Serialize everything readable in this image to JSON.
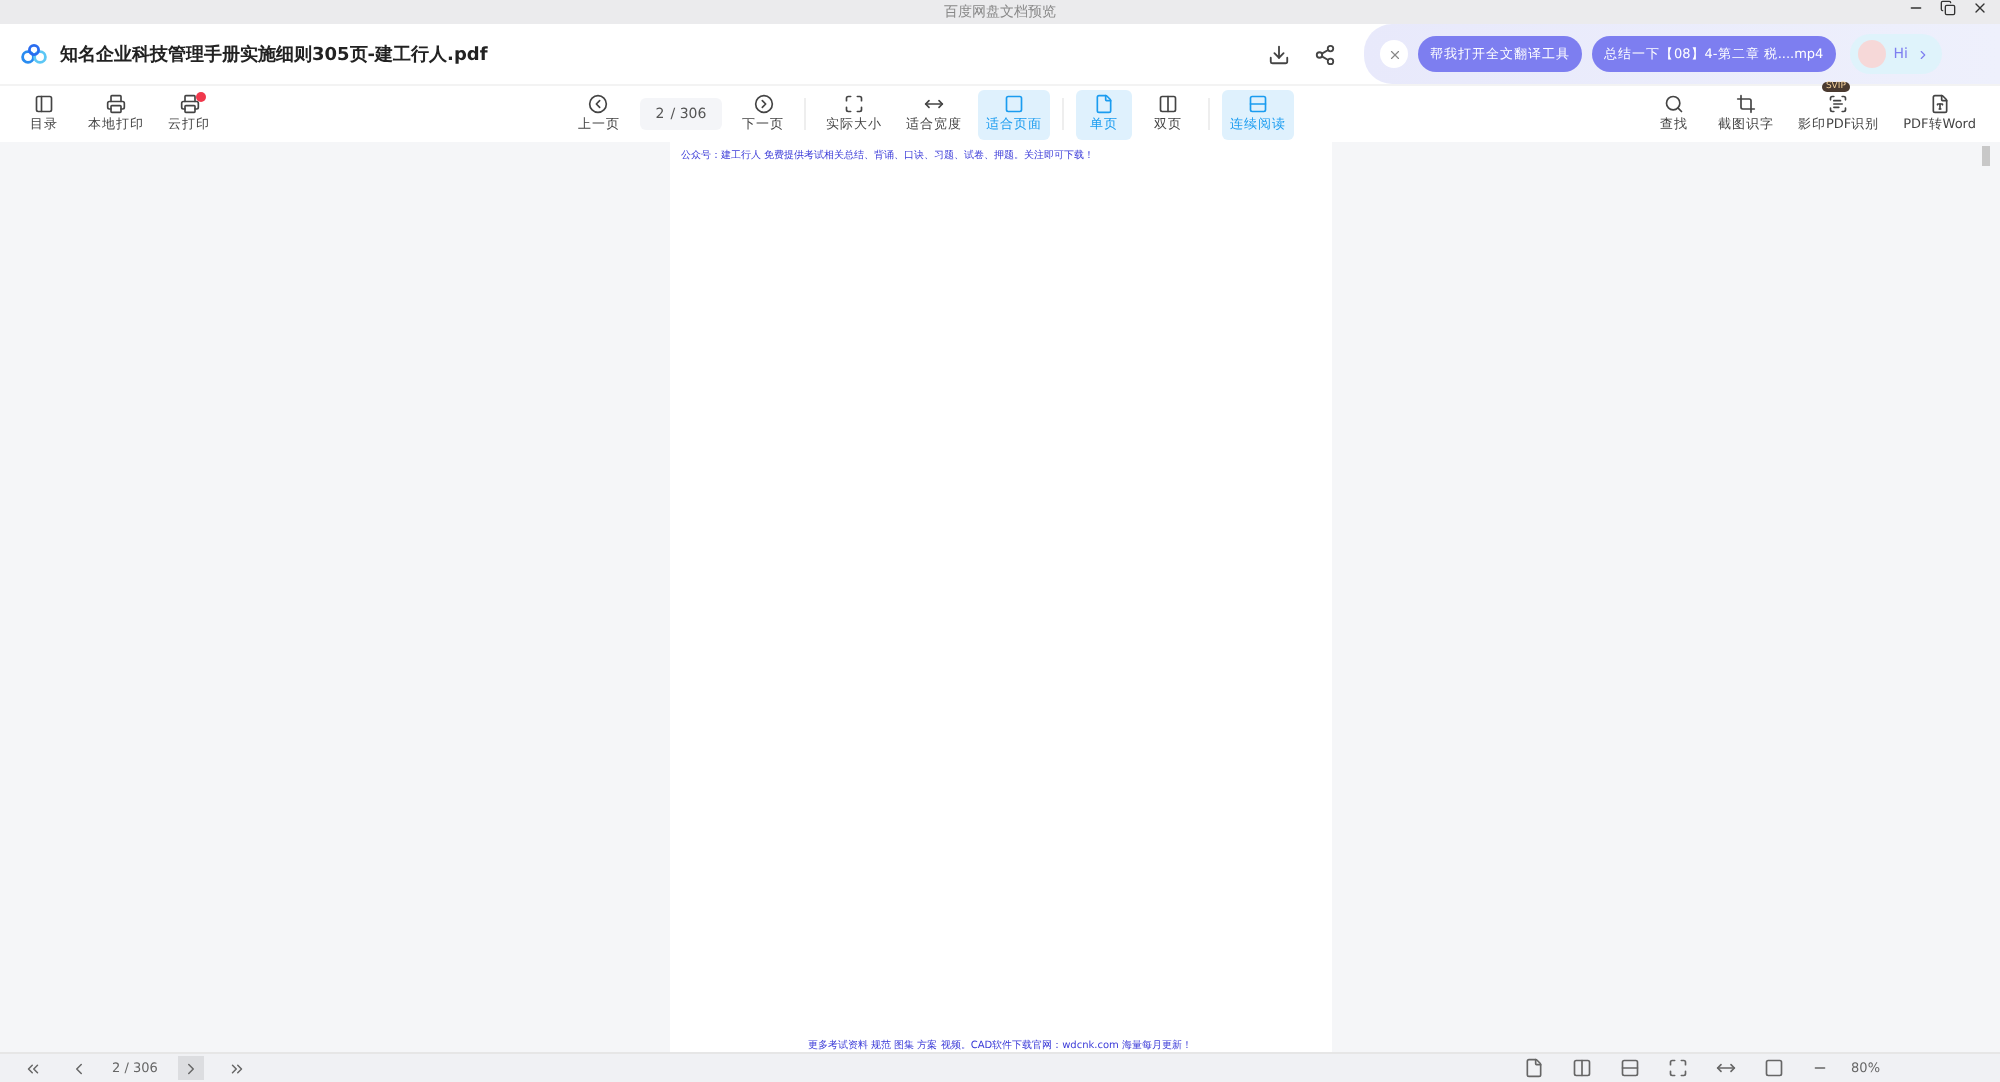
{
  "window": {
    "title": "百度网盘文档预览"
  },
  "document": {
    "title": "知名企业科技管理手册实施细则305页-建工行人.pdf"
  },
  "assistant": {
    "chips": [
      "帮我打开全文翻译工具",
      "总结一下【08】4-第二章 税....mp4"
    ],
    "greeting": "Hi"
  },
  "toolbar_left": [
    {
      "kind": "toc",
      "label": "目录"
    },
    {
      "kind": "print",
      "label": "本地打印"
    },
    {
      "kind": "cloud",
      "label": "云打印",
      "badge": true
    }
  ],
  "pager": {
    "prev": "上一页",
    "page": "2",
    "total": "/ 306",
    "next": "下一页"
  },
  "view_modes": [
    {
      "kind": "actual",
      "label": "实际大小",
      "selected": false
    },
    {
      "kind": "width",
      "label": "适合宽度",
      "selected": false
    },
    {
      "kind": "page",
      "label": "适合页面",
      "selected": true
    },
    {
      "kind": "single",
      "label": "单页",
      "selected": true
    },
    {
      "kind": "double",
      "label": "双页",
      "selected": false
    },
    {
      "kind": "scroll",
      "label": "连续阅读",
      "selected": true
    }
  ],
  "toolbar_right": [
    {
      "kind": "search",
      "label": "查找"
    },
    {
      "kind": "crop",
      "label": "截图识字"
    },
    {
      "kind": "scan",
      "label": "影印PDF识别",
      "badge": "SVIP"
    },
    {
      "kind": "convert",
      "label": "PDF转Word"
    }
  ],
  "page": {
    "header": "公众号：建工行人 免费提供考试相关总结、背诵、口诀、习题、试卷、押题。关注即可下载！",
    "footer": "更多考试资料 规范 图集 方案 视频。CAD软件下载官网：wdcnk.com 海量每月更新！"
  },
  "status_bar": {
    "page": "2",
    "total": "/ 306",
    "zoom": "80%"
  }
}
